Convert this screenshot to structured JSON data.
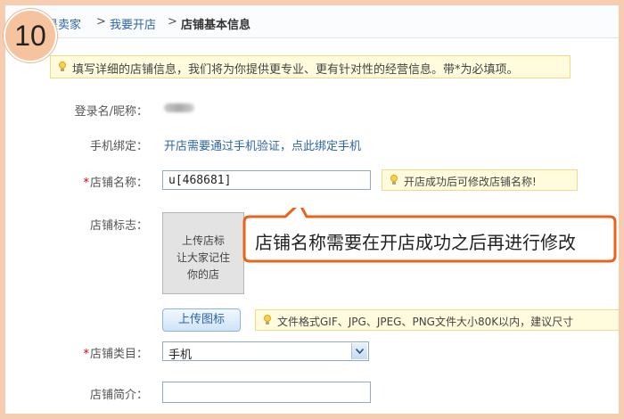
{
  "step": "10",
  "breadcrumb": {
    "home": "是卖家",
    "sep1": ">",
    "open_store": "我要开店",
    "sep2": ">",
    "current": "店铺基本信息"
  },
  "notice": "填写详细的店铺信息，我们将为你提供更专业、更有针对性的经营信息。带*为必填项。",
  "form": {
    "login_label": "登录名/昵称：",
    "phone_label": "手机绑定：",
    "phone_link": "开店需要通过手机验证，点此绑定手机",
    "name_label": "店铺名称：",
    "name_value": "u[468681]",
    "name_hint": "开店成功后可修改店铺名称!",
    "logo_label": "店铺标志：",
    "logo_placeholder_line1": "上传店标",
    "logo_placeholder_line2": "让大家记住",
    "logo_placeholder_line3": "你的店",
    "upload_button": "上传图标",
    "upload_hint": "文件格式GIF、JPG、JPEG、PNG文件大小80K以内，建议尺寸",
    "category_label": "店铺类目：",
    "category_value": "手机",
    "intro_label": "店铺简介：",
    "required_mark": "*"
  },
  "callout": "店铺名称需要在开店成功之后再进行修改",
  "colors": {
    "link": "#2b65a8",
    "required": "#d20000",
    "callout_border": "#e8641b",
    "hint_bg": "#fffbdc",
    "page_bg": "#f6cdb0"
  },
  "icons": [
    "lightbulb-icon",
    "dropdown-arrow-icon"
  ]
}
